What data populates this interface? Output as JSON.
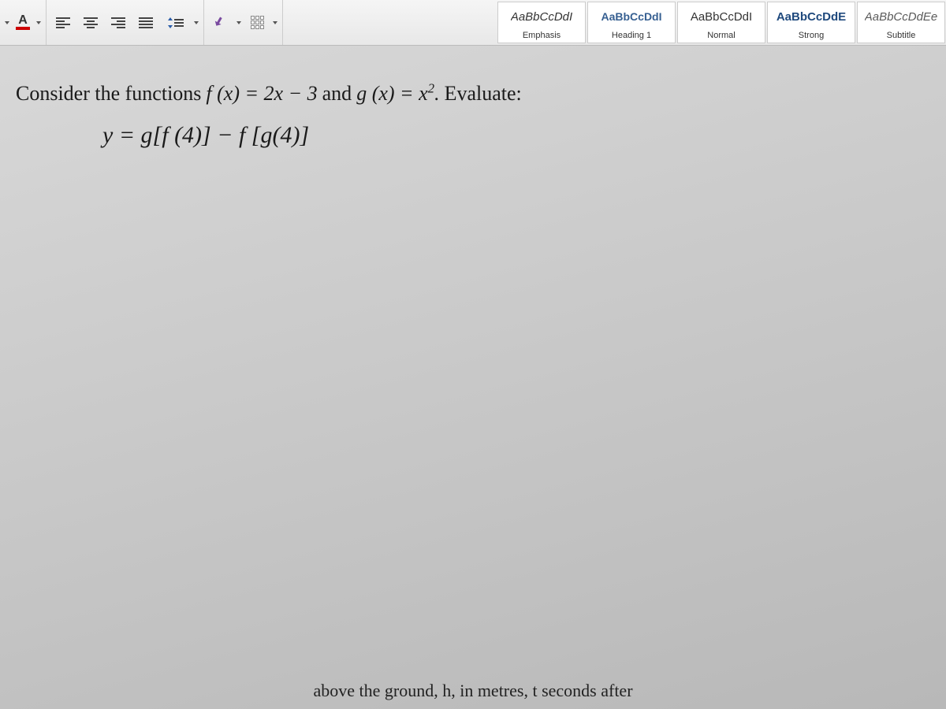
{
  "toolbar": {
    "font_color_letter": "A"
  },
  "styles": [
    {
      "preview": "AaBbCcDdI",
      "name": "Emphasis",
      "variant": "emphasis"
    },
    {
      "preview": "AaBbCcDdI",
      "name": "Heading 1",
      "variant": "heading"
    },
    {
      "preview": "AaBbCcDdI",
      "name": "Normal",
      "variant": ""
    },
    {
      "preview": "AaBbCcDdE",
      "name": "Strong",
      "variant": "strong"
    },
    {
      "preview": "AaBbCcDdEe",
      "name": "Subtitle",
      "variant": "subtitle"
    }
  ],
  "doc": {
    "intro1": "Consider the functions",
    "fx": "f (x) = 2x − 3",
    "and": "and",
    "gx_pre": "g (x) = x",
    "gx_exp": "2",
    "gx_post": ".",
    "evaluate": "Evaluate:",
    "expr": "y = g[f (4)] − f [g(4)]",
    "partial": "above the ground, h, in metres, t seconds after"
  }
}
